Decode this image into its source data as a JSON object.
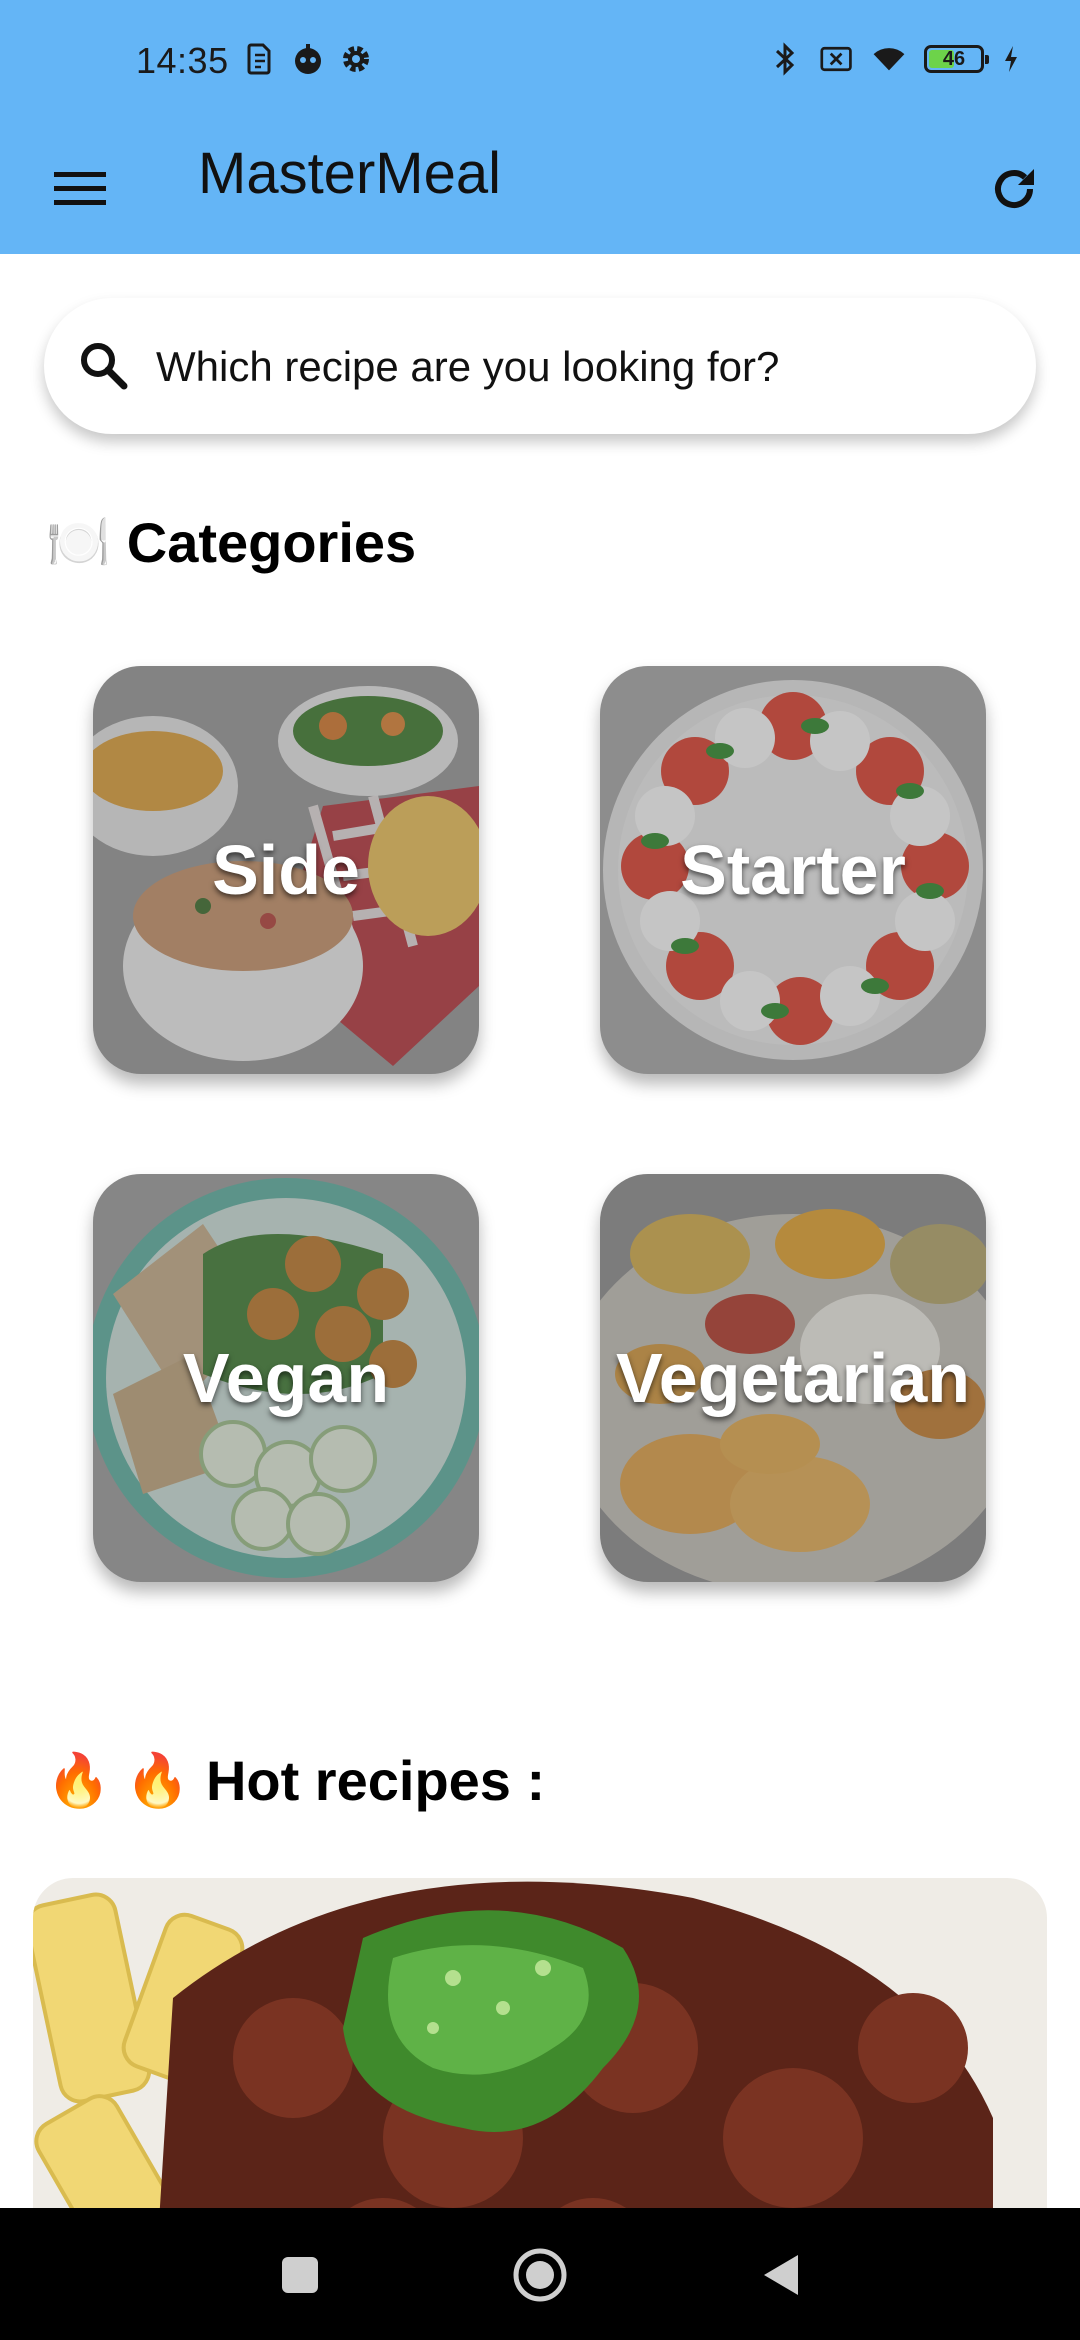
{
  "status_bar": {
    "time": "14:35",
    "battery_level": "46",
    "left_icons": [
      "sim-icon",
      "robot-icon",
      "gear-icon"
    ],
    "right_icons": [
      "bluetooth-icon",
      "sim-off-icon",
      "wifi-icon",
      "battery-icon",
      "charging-icon"
    ]
  },
  "app_bar": {
    "title": "MasterMeal",
    "menu_icon": "menu-icon",
    "refresh_icon": "refresh-icon",
    "background": "#64b5f6"
  },
  "search": {
    "placeholder": "Which recipe are you looking for?"
  },
  "categories": {
    "emoji": "🍽️",
    "title": "Categories",
    "items": [
      {
        "label": "Side"
      },
      {
        "label": "Starter"
      },
      {
        "label": "Vegan"
      },
      {
        "label": "Vegetarian"
      }
    ]
  },
  "hot": {
    "emoji": "🔥 🔥",
    "title": "Hot recipes :"
  },
  "nav": {
    "icons": [
      "recent-apps-icon",
      "home-icon",
      "back-icon"
    ]
  }
}
